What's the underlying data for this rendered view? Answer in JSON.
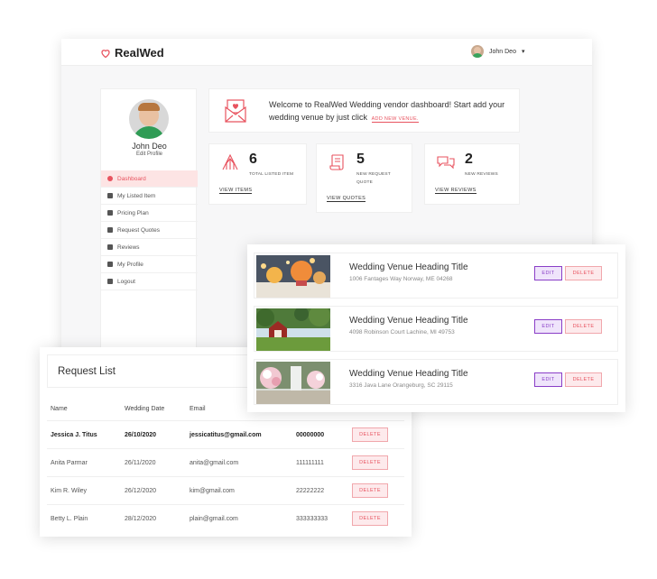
{
  "app": {
    "name": "RealWed"
  },
  "header": {
    "user_name": "John Deo"
  },
  "profile": {
    "name": "John Deo",
    "edit_label": "Edit Profile"
  },
  "sidebar": {
    "items": [
      {
        "label": "Dashboard",
        "icon": "dashboard-icon",
        "active": true
      },
      {
        "label": "My Listed Item",
        "icon": "list-icon",
        "active": false
      },
      {
        "label": "Pricing Plan",
        "icon": "pricing-icon",
        "active": false
      },
      {
        "label": "Request Quotes",
        "icon": "edit-icon",
        "active": false
      },
      {
        "label": "Reviews",
        "icon": "comments-icon",
        "active": false
      },
      {
        "label": "My Profile",
        "icon": "user-icon",
        "active": false
      },
      {
        "label": "Logout",
        "icon": "logout-icon",
        "active": false
      }
    ]
  },
  "welcome": {
    "text": "Welcome to RealWed Wedding vendor dashboard! Start add your wedding venue by just click",
    "link": "ADD NEW VENUE."
  },
  "stats": [
    {
      "value": "6",
      "label": "TOTAL LISTED ITEM",
      "link": "VIEW ITEMS",
      "icon": "tent-icon"
    },
    {
      "value": "5",
      "label": "NEW REQUEST QUOTE",
      "link": "VIEW QUOTES",
      "icon": "scroll-icon"
    },
    {
      "value": "2",
      "label": "NEW REVIEWS",
      "link": "VIEW REVIEWS",
      "icon": "chat-icon"
    }
  ],
  "venues": [
    {
      "title": "Wedding Venue Heading Title",
      "address": "1006 Fantages Way Norway, ME 04268",
      "edit": "EDIT",
      "delete": "DELETE"
    },
    {
      "title": "Wedding Venue Heading Title",
      "address": "4098 Robinson Court Lachine, MI 49753",
      "edit": "EDIT",
      "delete": "DELETE"
    },
    {
      "title": "Wedding Venue Heading Title",
      "address": "3316 Java Lane Orangeburg, SC 29115",
      "edit": "EDIT",
      "delete": "DELETE"
    }
  ],
  "requests": {
    "title": "Request List",
    "columns": [
      "Name",
      "Wedding Date",
      "Email"
    ],
    "delete_label": "DELETE",
    "rows": [
      {
        "name": "Jessica J. Titus",
        "date": "26/10/2020",
        "email": "jessicatitus@gmail.com",
        "phone": "00000000"
      },
      {
        "name": "Anita Parmar",
        "date": "26/11/2020",
        "email": "anita@gmail.com",
        "phone": "111111111"
      },
      {
        "name": "Kim R. Wiley",
        "date": "26/12/2020",
        "email": "kim@gmail.com",
        "phone": "22222222"
      },
      {
        "name": "Betty L. Plain",
        "date": "28/12/2020",
        "email": "plain@gmail.com",
        "phone": "333333333"
      }
    ]
  },
  "colors": {
    "accent": "#e8535f",
    "edit": "#8a3ec7",
    "active_bg": "#fde4e4"
  }
}
